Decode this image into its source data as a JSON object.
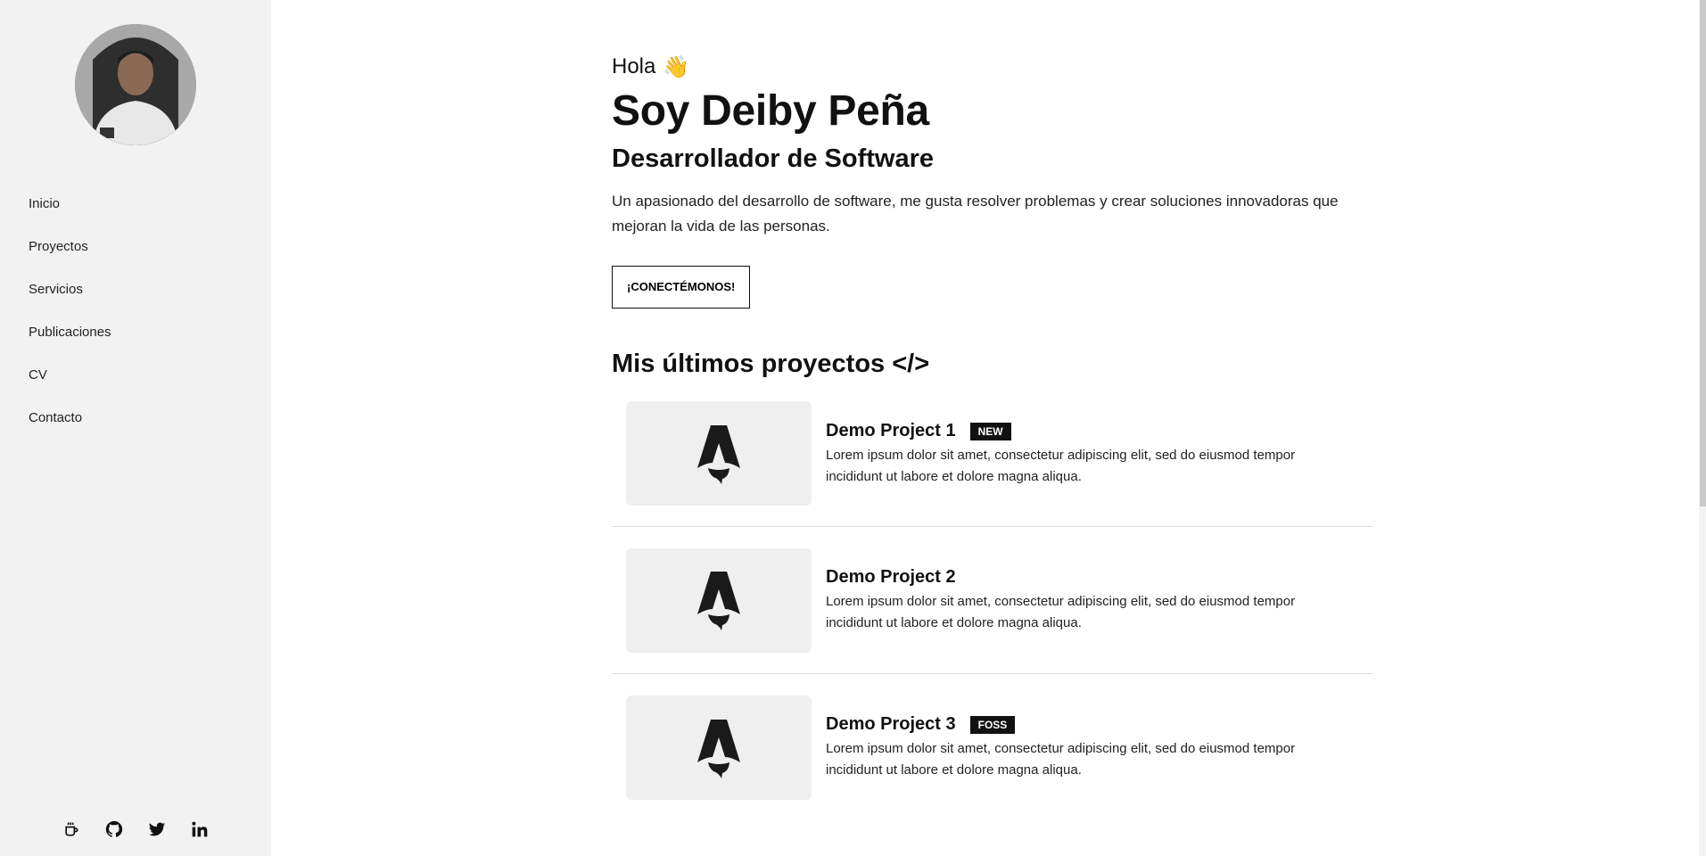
{
  "sidebar": {
    "nav": [
      {
        "label": "Inicio"
      },
      {
        "label": "Proyectos"
      },
      {
        "label": "Servicios"
      },
      {
        "label": "Publicaciones"
      },
      {
        "label": "CV"
      },
      {
        "label": "Contacto"
      }
    ],
    "social_icons": [
      "coffee-icon",
      "github-icon",
      "twitter-icon",
      "linkedin-icon"
    ]
  },
  "hero": {
    "greeting": "Hola",
    "greeting_emoji": "👋",
    "name": "Soy Deiby Peña",
    "role": "Desarrollador de Software",
    "description": "Un apasionado del desarrollo de software, me gusta resolver problemas y crear soluciones innovadoras que mejoran la vida de las personas.",
    "cta": "¡CONECTÉMONOS!"
  },
  "projects_section": {
    "title": "Mis últimos proyectos </>",
    "items": [
      {
        "title": "Demo Project 1",
        "badge": "NEW",
        "description": "Lorem ipsum dolor sit amet, consectetur adipiscing elit, sed do eiusmod tempor incididunt ut labore et dolore magna aliqua."
      },
      {
        "title": "Demo Project 2",
        "badge": "",
        "description": "Lorem ipsum dolor sit amet, consectetur adipiscing elit, sed do eiusmod tempor incididunt ut labore et dolore magna aliqua."
      },
      {
        "title": "Demo Project 3",
        "badge": "FOSS",
        "description": "Lorem ipsum dolor sit amet, consectetur adipiscing elit, sed do eiusmod tempor incididunt ut labore et dolore magna aliqua."
      }
    ]
  },
  "colors": {
    "sidebar_bg": "#f2f2f2",
    "text": "#111111",
    "badge_bg": "#111111",
    "thumb_bg": "#efefef"
  }
}
